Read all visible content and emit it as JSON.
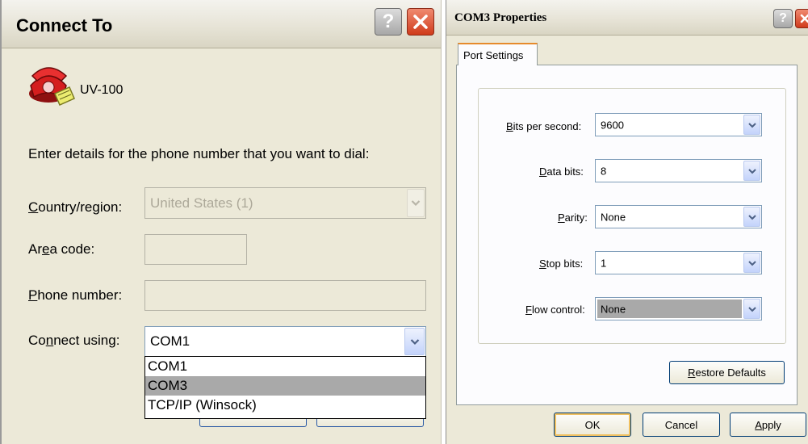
{
  "connect_dialog": {
    "title": "Connect To",
    "connection_name": "UV-100",
    "instructions": "Enter details for the phone number that you want to dial:",
    "country_label_pre": "",
    "country_label_u": "C",
    "country_label_post": "ountry/region:",
    "country_value": "United States (1)",
    "area_label_pre": "Ar",
    "area_label_u": "e",
    "area_label_post": "a code:",
    "area_value": "",
    "phone_label_pre": "",
    "phone_label_u": "P",
    "phone_label_post": "hone number:",
    "phone_value": "",
    "connect_label_pre": "Co",
    "connect_label_u": "n",
    "connect_label_post": "nect using:",
    "connect_value": "COM1",
    "connect_options": [
      "COM1",
      "COM3",
      "TCP/IP (Winsock)"
    ],
    "connect_selected_option": "COM3"
  },
  "com3_dialog": {
    "title": "COM3 Properties",
    "tab_label": "Port Settings",
    "bits_label_u": "B",
    "bits_label_post": "its per second:",
    "bits_value": "9600",
    "data_label_u": "D",
    "data_label_post": "ata bits:",
    "data_value": "8",
    "parity_label_u": "P",
    "parity_label_post": "arity:",
    "parity_value": "None",
    "stop_label_u": "S",
    "stop_label_post": "top bits:",
    "stop_value": "1",
    "flow_label_u": "F",
    "flow_label_post": "low control:",
    "flow_value": "None",
    "restore_u": "R",
    "restore_post": "estore Defaults",
    "ok_label": "OK",
    "cancel_label": "Cancel",
    "apply_u": "A",
    "apply_post": "pply"
  },
  "colors": {
    "dialog_bg": "#ece9d8",
    "field_border": "#7f9db9",
    "close_button": "#d03b1c",
    "tab_highlight": "#e68b2c",
    "listbox_selection": "#a9a9a9",
    "flow_selection": "#a9a9a9"
  },
  "icons": [
    "help-icon",
    "close-icon",
    "phone-icon",
    "chevron-down-icon"
  ]
}
